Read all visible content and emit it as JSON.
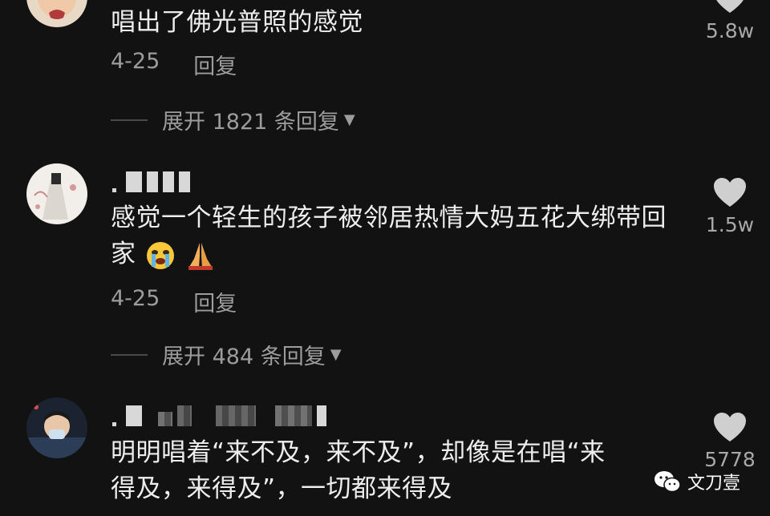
{
  "comments": [
    {
      "text": "唱出了佛光普照的感觉",
      "date": "4-25",
      "reply_label": "回复",
      "expand_label": "展开 1821 条回复",
      "likes": "5.8w"
    },
    {
      "text": "感觉一个轻生的孩子被邻居热情大妈五花大绑带回家",
      "emoji": [
        "loudly-crying-face-emoji",
        "folded-hands-emoji"
      ],
      "date": "4-25",
      "reply_label": "回复",
      "expand_label": "展开 484 条回复",
      "likes": "1.5w"
    },
    {
      "text_line1": "明明唱着“来不及，来不及”，却像是在唱“来",
      "text_line2": "得及，来得及”，一切都来得及",
      "likes": "5778"
    }
  ],
  "watermark": {
    "label": "文刀壹",
    "icon": "wechat-icon"
  },
  "colors": {
    "background": "#121212",
    "text": "#ededed",
    "secondary": "#9c9c9c",
    "heart": "#cfcfcf"
  }
}
